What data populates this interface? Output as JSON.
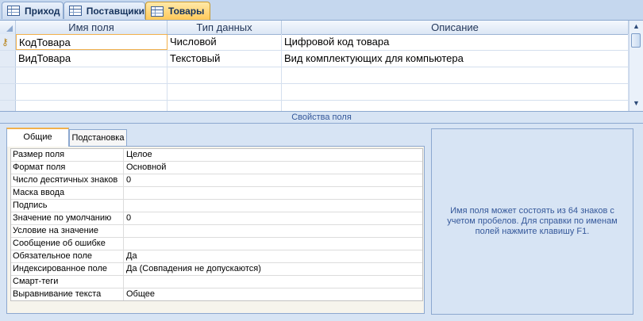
{
  "tabs": [
    {
      "label": "Приход",
      "active": false
    },
    {
      "label": "Поставщики",
      "active": false
    },
    {
      "label": "Товары",
      "active": true
    }
  ],
  "grid": {
    "columns": [
      "Имя поля",
      "Тип данных",
      "Описание"
    ],
    "rows": [
      {
        "name": "КодТовара",
        "type": "Числовой",
        "description": "Цифровой код товара",
        "primary_key": true
      },
      {
        "name": "ВидТовара",
        "type": "Текстовый",
        "description": "Вид комплектующих для компьютера",
        "primary_key": false
      }
    ]
  },
  "properties": {
    "header": "Свойства поля",
    "tabs": [
      "Общие",
      "Подстановка"
    ],
    "items": [
      {
        "name": "Размер поля",
        "value": "Целое"
      },
      {
        "name": "Формат поля",
        "value": "Основной"
      },
      {
        "name": "Число десятичных знаков",
        "value": "0"
      },
      {
        "name": "Маска ввода",
        "value": ""
      },
      {
        "name": "Подпись",
        "value": ""
      },
      {
        "name": "Значение по умолчанию",
        "value": "0"
      },
      {
        "name": "Условие на значение",
        "value": ""
      },
      {
        "name": "Сообщение об ошибке",
        "value": ""
      },
      {
        "name": "Обязательное поле",
        "value": "Да"
      },
      {
        "name": "Индексированное поле",
        "value": "Да (Совпадения не допускаются)"
      },
      {
        "name": "Смарт-теги",
        "value": ""
      },
      {
        "name": "Выравнивание текста",
        "value": "Общее"
      }
    ],
    "help_text": "Имя поля может состоять из 64 знаков с учетом пробелов.  Для справки по именам полей нажмите клавишу F1."
  }
}
